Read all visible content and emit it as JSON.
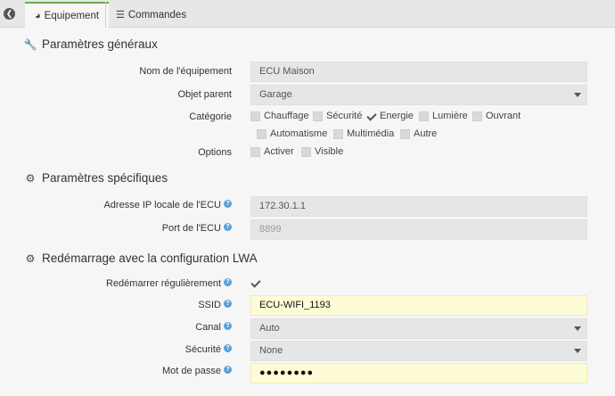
{
  "tabs": [
    {
      "label": "Equipement",
      "icon": "tachometer-icon"
    },
    {
      "label": "Commandes",
      "icon": "list-icon"
    }
  ],
  "general": {
    "title": "Paramètres généraux",
    "name_label": "Nom de l'équipement",
    "name_value": "ECU Maison",
    "parent_label": "Objet parent",
    "parent_value": "Garage",
    "category_label": "Catégorie",
    "categories": [
      {
        "label": "Chauffage",
        "checked": false
      },
      {
        "label": "Sécurité",
        "checked": false
      },
      {
        "label": "Energie",
        "checked": true
      },
      {
        "label": "Lumière",
        "checked": false
      },
      {
        "label": "Ouvrant",
        "checked": false
      },
      {
        "label": "Automatisme",
        "checked": false
      },
      {
        "label": "Multimédia",
        "checked": false
      },
      {
        "label": "Autre",
        "checked": false
      }
    ],
    "options_label": "Options",
    "options": [
      {
        "label": "Activer",
        "checked": false
      },
      {
        "label": "Visible",
        "checked": false
      }
    ]
  },
  "specific": {
    "title": "Paramètres spécifiques",
    "ip_label": "Adresse IP locale de l'ECU",
    "ip_value": "172.30.1.1",
    "port_label": "Port de l'ECU",
    "port_value": "8899"
  },
  "restart": {
    "title": "Redémarrage avec la configuration LWA",
    "reboot_label": "Redémarrer régulièrement",
    "reboot_checked": true,
    "ssid_label": "SSID",
    "ssid_value": "ECU-WIFI_1193",
    "channel_label": "Canal",
    "channel_value": "Auto",
    "security_label": "Sécurité",
    "security_value": "None",
    "password_label": "Mot de passe",
    "password_value": "●●●●●●●●"
  },
  "help_glyph": "?",
  "colors": {
    "accent": "#6aa84f",
    "help": "#5aa0d8",
    "highlight": "#fefcd7"
  }
}
